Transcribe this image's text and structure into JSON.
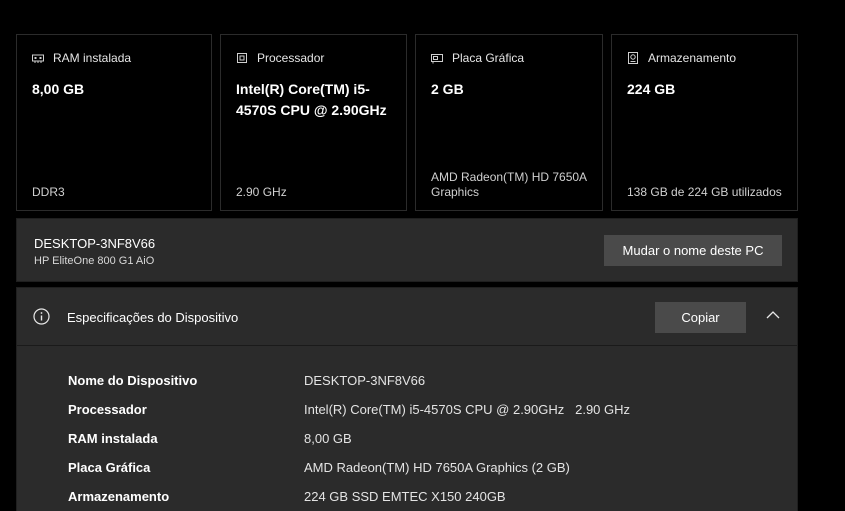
{
  "cards": [
    {
      "label": "RAM instalada",
      "value": "8,00 GB",
      "foot": "DDR3",
      "icon": "ram-icon"
    },
    {
      "label": "Processador",
      "value": "Intel(R) Core(TM) i5-4570S CPU @ 2.90GHz",
      "foot": "2.90 GHz",
      "icon": "processor-icon"
    },
    {
      "label": "Placa Gráfica",
      "value": "2 GB",
      "foot": "AMD Radeon(TM) HD 7650A Graphics",
      "icon": "graphics-card-icon"
    },
    {
      "label": "Armazenamento",
      "value": "224 GB",
      "foot": "138 GB de 224 GB utilizados",
      "icon": "storage-icon"
    }
  ],
  "pc": {
    "name": "DESKTOP-3NF8V66",
    "model": "HP EliteOne 800 G1 AiO",
    "rename_label": "Mudar o nome deste PC"
  },
  "specs": {
    "title": "Especificações do Dispositivo",
    "copy_label": "Copiar",
    "rows": [
      {
        "key": "Nome do Dispositivo",
        "value": "DESKTOP-3NF8V66"
      },
      {
        "key": "Processador",
        "value": "Intel(R) Core(TM) i5-4570S CPU @ 2.90GHz   2.90 GHz"
      },
      {
        "key": "RAM instalada",
        "value": "8,00 GB"
      },
      {
        "key": "Placa Gráfica",
        "value": "AMD Radeon(TM) HD 7650A Graphics (2 GB)"
      },
      {
        "key": "Armazenamento",
        "value": "224 GB SSD EMTEC X150 240GB"
      }
    ]
  }
}
